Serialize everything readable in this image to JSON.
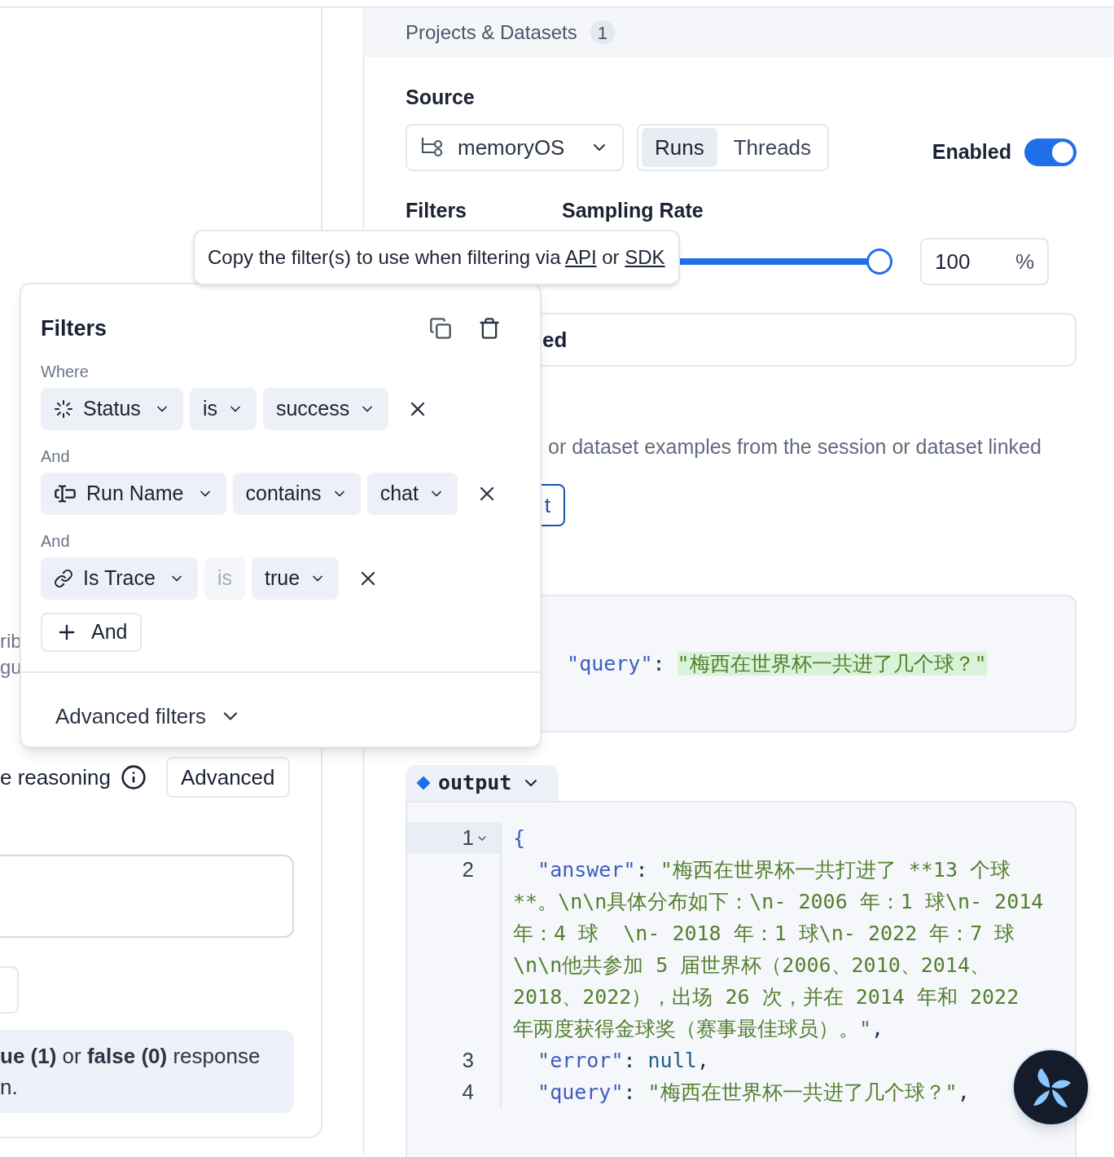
{
  "left_panel": {
    "note_lines": [
      "rib",
      "gu"
    ],
    "reasoning_label": "e reasoning",
    "advanced_button": "Advanced",
    "info_lines": [
      "**ue (1)** or **false (0)** response",
      "n."
    ]
  },
  "right_panel": {
    "header": {
      "title": "Projects & Datasets",
      "count": "1"
    },
    "source": {
      "label": "Source",
      "project": "memoryOS",
      "modes": [
        {
          "label": "Runs",
          "selected": true
        },
        {
          "label": "Threads",
          "selected": false
        }
      ],
      "enabled_label": "Enabled",
      "enabled": true
    },
    "filters_label": "Filters",
    "sampling": {
      "label": "Sampling Rate",
      "level": 1,
      "value": "100",
      "unit": "%"
    },
    "section_title": "ed",
    "description": "or dataset examples from the session or dataset linked",
    "button_text": "t",
    "input_preview": [
      {
        "kind": "key",
        "text": "\"query\""
      },
      {
        "kind": "punct",
        "text": ": "
      },
      {
        "kind": "string",
        "text": "\"梅西在世界杯一共进了几个球？\"",
        "highlighted": true
      }
    ],
    "output": {
      "tab": "output",
      "lines": [
        {
          "number": "1",
          "foldable": true,
          "current": true,
          "tokens": [
            {
              "kind": "brace",
              "text": "{"
            }
          ]
        },
        {
          "number": "2",
          "foldable": false,
          "current": false,
          "tokens": [
            {
              "kind": "key",
              "text": "\"answer\""
            },
            {
              "kind": "punct",
              "text": ": "
            },
            {
              "kind": "string",
              "text": "\"梅西在世界杯一共打进了 **13 个球**。\\n\\n具体分布如下：\\n- 2006 年：1 球\\n- 2014 年：4 球  \\n- 2018 年：1 球\\n- 2022 年：7 球  \\n\\n他共参加 5 届世界杯（2006、2010、2014、2018、2022），出场 26 次，并在 2014 年和 2022 年两度获得金球奖（赛事最佳球员）。\""
            },
            {
              "kind": "punct",
              "text": ","
            }
          ]
        },
        {
          "number": "3",
          "foldable": false,
          "current": false,
          "tokens": [
            {
              "kind": "key",
              "text": "\"error\""
            },
            {
              "kind": "punct",
              "text": ": "
            },
            {
              "kind": "keyword",
              "text": "null"
            },
            {
              "kind": "punct",
              "text": ","
            }
          ]
        },
        {
          "number": "4",
          "foldable": false,
          "current": false,
          "tokens": [
            {
              "kind": "key",
              "text": "\"query\""
            },
            {
              "kind": "punct",
              "text": ": "
            },
            {
              "kind": "string",
              "text": "\"梅西在世界杯一共进了几个球？\""
            },
            {
              "kind": "punct",
              "text": ","
            }
          ]
        }
      ]
    }
  },
  "tooltip": {
    "parts": [
      {
        "kind": "text",
        "text": "Copy the filter(s) to use when filtering via "
      },
      {
        "kind": "link",
        "text": "API"
      },
      {
        "kind": "text",
        "text": " or "
      },
      {
        "kind": "link",
        "text": "SDK"
      }
    ]
  },
  "filter_popover": {
    "title": "Filters",
    "filters": [
      {
        "connector": "Where",
        "field": "Status",
        "kind": "status",
        "operator": "is",
        "operator_disabled": false,
        "value": "success"
      },
      {
        "connector": "And",
        "field": "Run Name",
        "kind": "run_name",
        "operator": "contains",
        "operator_disabled": false,
        "value": "chat"
      },
      {
        "connector": "And",
        "field": "Is Trace",
        "kind": "trace",
        "operator": "is",
        "operator_disabled": true,
        "value": "true"
      }
    ],
    "add_label": "And",
    "advanced_label": "Advanced filters"
  }
}
